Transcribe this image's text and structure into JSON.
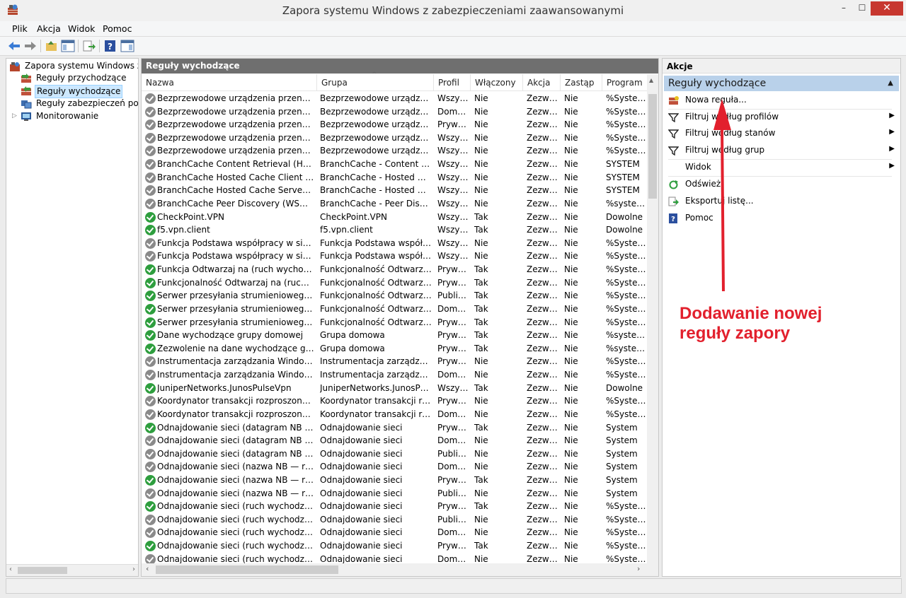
{
  "window": {
    "title": "Zapora systemu Windows z zabezpieczeniami zaawansowanymi",
    "minimize": "–",
    "maximize": "☐",
    "close": "✕"
  },
  "menu": [
    "Plik",
    "Akcja",
    "Widok",
    "Pomoc"
  ],
  "tree": {
    "root": "Zapora systemu Windows z zabezpieczeniami zaawansowanymi",
    "items": [
      "Reguły przychodzące",
      "Reguły wychodzące",
      "Reguły zabezpieczeń połączeń",
      "Monitorowanie"
    ],
    "selected_index": 1
  },
  "panel": {
    "title": "Reguły wychodzące",
    "columns": [
      "Nazwa",
      "Grupa",
      "Profil",
      "Włączony",
      "Akcja",
      "Zastąp",
      "Program"
    ],
    "sort_indicator": "^",
    "rows": [
      [
        "Bezprzewodowe urządzenia przenośne (ruch wychodzący)",
        "Bezprzewodowe urządzenia przenośne",
        "Wszystkie",
        "Nie",
        "Zezwalaj",
        "Nie",
        "%SystemRoot%"
      ],
      [
        "Bezprzewodowe urządzenia przenośne (ruch wychodzący)",
        "Bezprzewodowe urządzenia przenośne",
        "Domena",
        "Nie",
        "Zezwalaj",
        "Nie",
        "%SystemRoot%"
      ],
      [
        "Bezprzewodowe urządzenia przenośne (ruch wychodzący)",
        "Bezprzewodowe urządzenia przenośne",
        "Prywatny",
        "Nie",
        "Zezwalaj",
        "Nie",
        "%SystemRoot%"
      ],
      [
        "Bezprzewodowe urządzenia przenośne (ruch wychodzący)",
        "Bezprzewodowe urządzenia przenośne",
        "Wszystkie",
        "Nie",
        "Zezwalaj",
        "Nie",
        "%SystemRoot%"
      ],
      [
        "Bezprzewodowe urządzenia przenośne (ruch wychodzący)",
        "Bezprzewodowe urządzenia przenośne",
        "Wszystkie",
        "Nie",
        "Zezwalaj",
        "Nie",
        "%SystemRoot%"
      ],
      [
        "BranchCache Content Retrieval (HTTP-Out)",
        "BranchCache - Content Retrieval",
        "Wszystkie",
        "Nie",
        "Zezwalaj",
        "Nie",
        "SYSTEM"
      ],
      [
        "BranchCache Hosted Cache Client (HTTP-Out)",
        "BranchCache - Hosted Cache Client",
        "Wszystkie",
        "Nie",
        "Zezwalaj",
        "Nie",
        "SYSTEM"
      ],
      [
        "BranchCache Hosted Cache Server(HTTP-Out)",
        "BranchCache - Hosted Cache Server",
        "Wszystkie",
        "Nie",
        "Zezwalaj",
        "Nie",
        "SYSTEM"
      ],
      [
        "BranchCache Peer Discovery (WSD-Out)",
        "BranchCache - Peer Discovery",
        "Wszystkie",
        "Nie",
        "Zezwalaj",
        "Nie",
        "%systemroot%"
      ],
      [
        "CheckPoint.VPN",
        "CheckPoint.VPN",
        "Wszystkie",
        "Tak",
        "Zezwalaj",
        "Nie",
        "Dowolne"
      ],
      [
        "f5.vpn.client",
        "f5.vpn.client",
        "Wszystkie",
        "Tak",
        "Zezwalaj",
        "Nie",
        "Dowolne"
      ],
      [
        "Funkcja Podstawa współpracy w sieci równorzędnej",
        "Funkcja Podstawa współpracy",
        "Wszystkie",
        "Nie",
        "Zezwalaj",
        "Nie",
        "%SystemRoot%"
      ],
      [
        "Funkcja Podstawa współpracy w sieci równorzędnej",
        "Funkcja Podstawa współpracy",
        "Wszystkie",
        "Nie",
        "Zezwalaj",
        "Nie",
        "%SystemRoot%"
      ],
      [
        "Funkcja Odtwarzaj na (ruch wychodzący)",
        "Funkcjonalność Odtwarzaj na",
        "Prywatny",
        "Tak",
        "Zezwalaj",
        "Nie",
        "%SystemRoot%"
      ],
      [
        "Funkcjonalność Odtwarzaj na (ruch wychodzący)",
        "Funkcjonalność Odtwarzaj na",
        "Prywatny",
        "Tak",
        "Zezwalaj",
        "Nie",
        "%SystemRoot%"
      ],
      [
        "Serwer przesyłania strumieniowego funkcji",
        "Funkcjonalność Odtwarzaj na",
        "Publiczny",
        "Tak",
        "Zezwalaj",
        "Nie",
        "%SystemRoot%"
      ],
      [
        "Serwer przesyłania strumieniowego funkcji",
        "Funkcjonalność Odtwarzaj na",
        "Domena",
        "Tak",
        "Zezwalaj",
        "Nie",
        "%SystemRoot%"
      ],
      [
        "Serwer przesyłania strumieniowego funkcji",
        "Funkcjonalność Odtwarzaj na",
        "Prywatny",
        "Tak",
        "Zezwalaj",
        "Nie",
        "%SystemRoot%"
      ],
      [
        "Dane wychodzące grupy domowej",
        "Grupa domowa",
        "Prywatny",
        "Tak",
        "Zezwalaj",
        "Nie",
        "%systemroot%"
      ],
      [
        "Zezwolenie na dane wychodzące grupy domowej",
        "Grupa domowa",
        "Prywatny",
        "Tak",
        "Zezwalaj",
        "Nie",
        "%systemroot%"
      ],
      [
        "Instrumentacja zarządzania Windows (ruch wychodzący)",
        "Instrumentacja zarządzania Windows",
        "Prywatny",
        "Nie",
        "Zezwalaj",
        "Nie",
        "%SystemRoot%"
      ],
      [
        "Instrumentacja zarządzania Windows (ruch wychodzący)",
        "Instrumentacja zarządzania Windows",
        "Domena",
        "Nie",
        "Zezwalaj",
        "Nie",
        "%SystemRoot%"
      ],
      [
        "JuniperNetworks.JunosPulseVpn",
        "JuniperNetworks.JunosPulseVpn",
        "Wszystkie",
        "Tak",
        "Zezwalaj",
        "Nie",
        "Dowolne"
      ],
      [
        "Koordynator transakcji rozproszonych (ruch wychodzący)",
        "Koordynator transakcji rozproszonych",
        "Prywatny",
        "Nie",
        "Zezwalaj",
        "Nie",
        "%SystemRoot%"
      ],
      [
        "Koordynator transakcji rozproszonych (ruch wychodzący)",
        "Koordynator transakcji rozproszonych",
        "Domena",
        "Nie",
        "Zezwalaj",
        "Nie",
        "%SystemRoot%"
      ],
      [
        "Odnajdowanie sieci (datagram NB — ruch wychodzący)",
        "Odnajdowanie sieci",
        "Prywatny",
        "Tak",
        "Zezwalaj",
        "Nie",
        "System"
      ],
      [
        "Odnajdowanie sieci (datagram NB — ruch wychodzący)",
        "Odnajdowanie sieci",
        "Domena",
        "Nie",
        "Zezwalaj",
        "Nie",
        "System"
      ],
      [
        "Odnajdowanie sieci (datagram NB — ruch wychodzący)",
        "Odnajdowanie sieci",
        "Publiczny",
        "Nie",
        "Zezwalaj",
        "Nie",
        "System"
      ],
      [
        "Odnajdowanie sieci (nazwa NB — ruch wychodzący)",
        "Odnajdowanie sieci",
        "Domena",
        "Nie",
        "Zezwalaj",
        "Nie",
        "System"
      ],
      [
        "Odnajdowanie sieci (nazwa NB — ruch wychodzący)",
        "Odnajdowanie sieci",
        "Prywatny",
        "Tak",
        "Zezwalaj",
        "Nie",
        "System"
      ],
      [
        "Odnajdowanie sieci (nazwa NB — ruch wychodzący)",
        "Odnajdowanie sieci",
        "Publiczny",
        "Nie",
        "Zezwalaj",
        "Nie",
        "System"
      ],
      [
        "Odnajdowanie sieci (ruch wychodzący bez pośrednika)",
        "Odnajdowanie sieci",
        "Prywatny",
        "Tak",
        "Zezwalaj",
        "Nie",
        "%SystemRoot%"
      ],
      [
        "Odnajdowanie sieci (ruch wychodzący bez pośrednika)",
        "Odnajdowanie sieci",
        "Publiczny",
        "Nie",
        "Zezwalaj",
        "Nie",
        "%SystemRoot%"
      ],
      [
        "Odnajdowanie sieci (ruch wychodzący bez pośrednika)",
        "Odnajdowanie sieci",
        "Domena",
        "Nie",
        "Zezwalaj",
        "Nie",
        "%SystemRoot%"
      ],
      [
        "Odnajdowanie sieci (ruch wychodzący LLMNR-UDP)",
        "Odnajdowanie sieci",
        "Prywatny",
        "Tak",
        "Zezwalaj",
        "Nie",
        "%SystemRoot%"
      ],
      [
        "Odnajdowanie sieci (ruch wychodzący LLMNR-UDP)",
        "Odnajdowanie sieci",
        "Domena",
        "Nie",
        "Zezwalaj",
        "Nie",
        "%SystemRoot%"
      ]
    ]
  },
  "actions": {
    "title": "Akcje",
    "section": "Reguły wychodzące",
    "items": [
      {
        "label": "Nowa reguła...",
        "submenu": false,
        "icon": "new-rule-icon"
      },
      {
        "label": "Filtruj według profilów",
        "submenu": true,
        "icon": "filter-icon"
      },
      {
        "label": "Filtruj według stanów",
        "submenu": true,
        "icon": "filter-icon"
      },
      {
        "label": "Filtruj według grup",
        "submenu": true,
        "icon": "filter-icon"
      },
      {
        "label": "Widok",
        "submenu": true,
        "icon": ""
      },
      {
        "label": "Odśwież",
        "submenu": false,
        "icon": "refresh-icon"
      },
      {
        "label": "Eksportuj listę...",
        "submenu": false,
        "icon": "export-icon"
      },
      {
        "label": "Pomoc",
        "submenu": false,
        "icon": "help-icon"
      }
    ]
  },
  "annotation": {
    "line1": "Dodawanie nowej",
    "line2": "reguły zapory",
    "color": "#e2202d"
  },
  "colors": {
    "enabled_icon": "#2e9e3e",
    "disabled_icon": "#8a8a8a",
    "section_bg": "#b9d1ea",
    "panel_title_bg": "#6f6f6f"
  }
}
